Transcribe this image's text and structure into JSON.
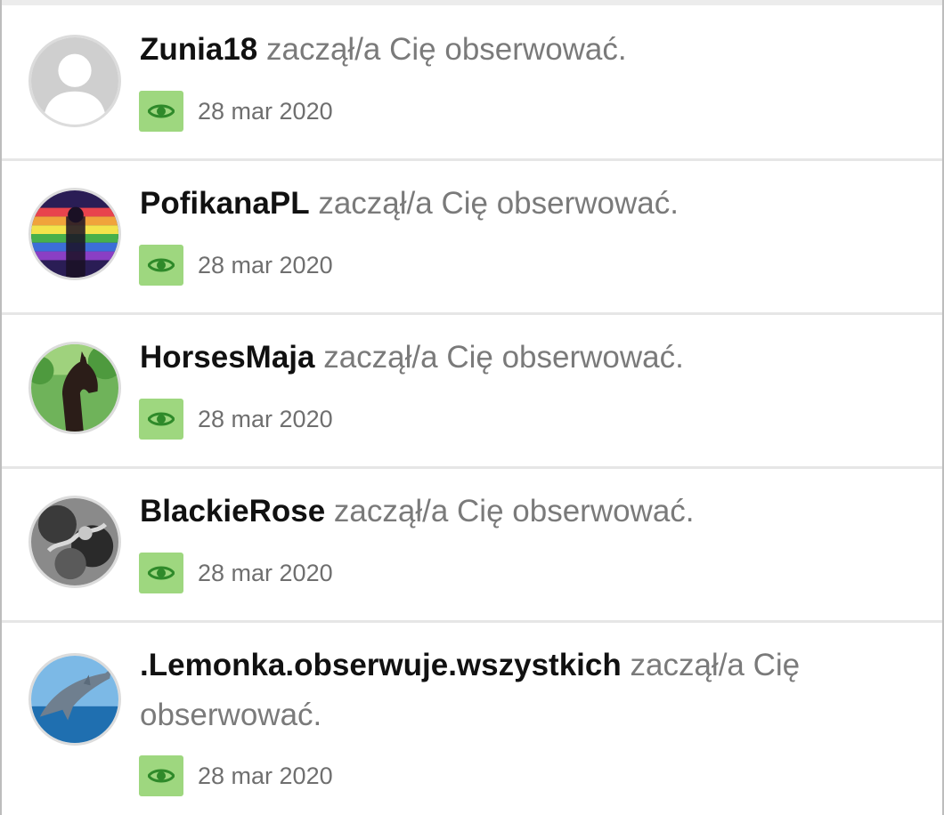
{
  "notifications": [
    {
      "username": "Zunia18",
      "message": "zaczął/a Cię obserwować.",
      "date": "28 mar 2020",
      "avatar_icon": "default-user-avatar"
    },
    {
      "username": "PofikanaPL",
      "message": "zaczął/a Cię obserwować.",
      "date": "28 mar 2020",
      "avatar_icon": "rainbow-photo-avatar"
    },
    {
      "username": "HorsesMaja",
      "message": "zaczął/a Cię obserwować.",
      "date": "28 mar 2020",
      "avatar_icon": "horse-photo-avatar"
    },
    {
      "username": "BlackieRose",
      "message": "zaczął/a Cię obserwować.",
      "date": "28 mar 2020",
      "avatar_icon": "bw-photo-avatar"
    },
    {
      "username": ".Lemonka.obserwuje.wszystkich",
      "message": "zaczął/a Cię obserwować.",
      "date": "28 mar 2020",
      "avatar_icon": "dolphin-photo-avatar"
    }
  ],
  "colors": {
    "badge_bg": "#9ed77f",
    "eye": "#2f8a2a",
    "username": "#111111",
    "message": "#7a7a7a"
  }
}
